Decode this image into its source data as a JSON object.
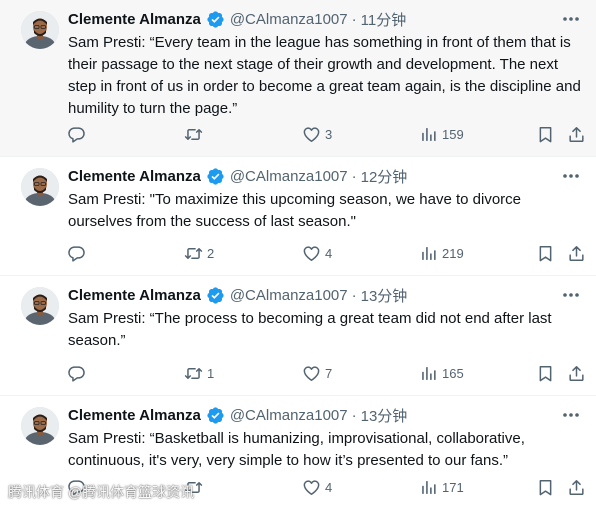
{
  "colors": {
    "accent_verified": "#1d9bf0",
    "text_secondary": "#536471",
    "text_primary": "#0f1419",
    "highlight_bg": "#f7f7f7"
  },
  "icons": {
    "verified": "verified-badge-icon",
    "more": "more-options-icon",
    "reply": "reply-icon",
    "retweet": "retweet-icon",
    "like": "like-icon",
    "views": "views-icon",
    "bookmark": "bookmark-icon",
    "share": "share-icon"
  },
  "tweets": [
    {
      "name": "Clemente Almanza",
      "handle": "@CAlmanza1007",
      "separator": "·",
      "time": "11分钟",
      "text": "Sam Presti: “Every team in the league has something in front of them that is their passage to the next stage of their growth and development. The next step in front of us in order to become a great team again, is the discipline and humility to turn the page.”",
      "replies": "",
      "retweets": "",
      "likes": "3",
      "views": "159"
    },
    {
      "name": "Clemente Almanza",
      "handle": "@CAlmanza1007",
      "separator": "·",
      "time": "12分钟",
      "text": "Sam Presti: \"To maximize this upcoming season, we have to divorce ourselves from the success of last season.\"",
      "replies": "",
      "retweets": "2",
      "likes": "4",
      "views": "219"
    },
    {
      "name": "Clemente Almanza",
      "handle": "@CAlmanza1007",
      "separator": "·",
      "time": "13分钟",
      "text": "Sam Presti: “The process to becoming a great team did not end after last season.”",
      "replies": "",
      "retweets": "1",
      "likes": "7",
      "views": "165"
    },
    {
      "name": "Clemente Almanza",
      "handle": "@CAlmanza1007",
      "separator": "·",
      "time": "13分钟",
      "text": "Sam Presti: “Basketball is humanizing, improvisational, collaborative, continuous, it's very, very simple to how it’s presented to our fans.”",
      "replies": "",
      "retweets": "",
      "likes": "4",
      "views": "171"
    }
  ],
  "watermark": "腾讯体育 @腾讯体育篮球资讯"
}
